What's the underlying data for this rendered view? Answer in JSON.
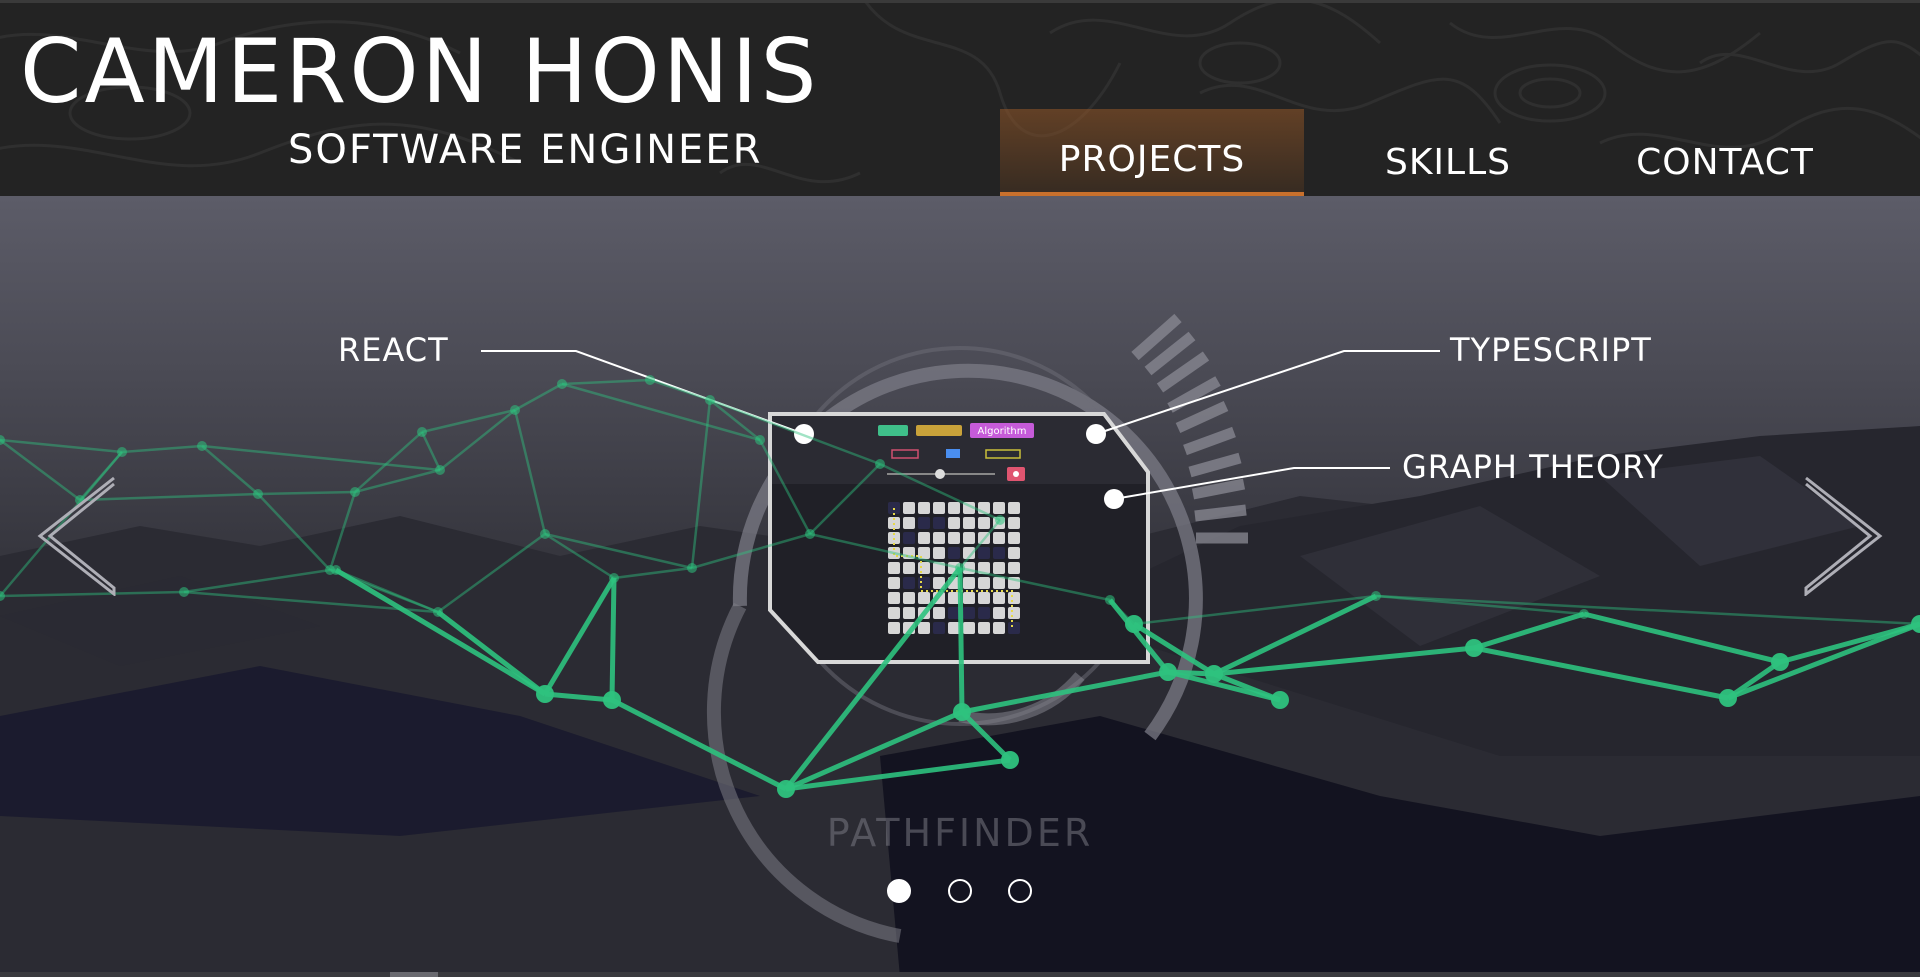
{
  "header": {
    "name": "CAMERON HONIS",
    "title": "SOFTWARE ENGINEER",
    "nav": [
      {
        "label": "PROJECTS",
        "active": true
      },
      {
        "label": "SKILLS",
        "active": false
      },
      {
        "label": "CONTACT",
        "active": false
      }
    ]
  },
  "carousel": {
    "current_index": 1,
    "total": 3,
    "project": {
      "name": "PATHFINDER",
      "tags": [
        "REACT",
        "TYPESCRIPT",
        "GRAPH THEORY"
      ],
      "preview": {
        "button_text": "Algorithm"
      }
    }
  },
  "colors": {
    "accent": "#c8702c",
    "header_bg": "#232323",
    "mesh_green": "#2ec27e"
  }
}
